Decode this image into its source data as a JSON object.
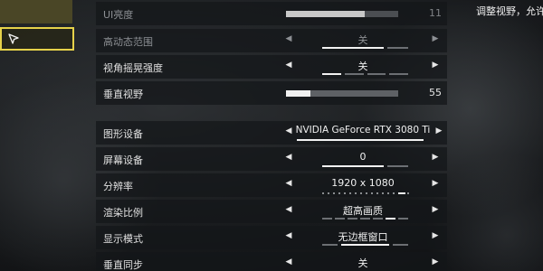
{
  "note": "调整视野，允许",
  "rows": [
    {
      "label": "UI亮度",
      "slider_value": "11",
      "slider_fraction": 0.7
    },
    {
      "label": "高动态范围",
      "value": "关"
    },
    {
      "label": "视角摇晃强度",
      "value": "关"
    },
    {
      "label": "垂直视野",
      "slider_value": "55",
      "slider_fraction": 0.22
    },
    {
      "label": "图形设备",
      "value": "NVIDIA GeForce RTX 3080 Ti"
    },
    {
      "label": "屏幕设备",
      "value": "0"
    },
    {
      "label": "分辨率",
      "value": "1920 x 1080"
    },
    {
      "label": "渲染比例",
      "value": "超高画质"
    },
    {
      "label": "显示模式",
      "value": "无边框窗口"
    },
    {
      "label": "垂直同步",
      "value": "关"
    }
  ]
}
